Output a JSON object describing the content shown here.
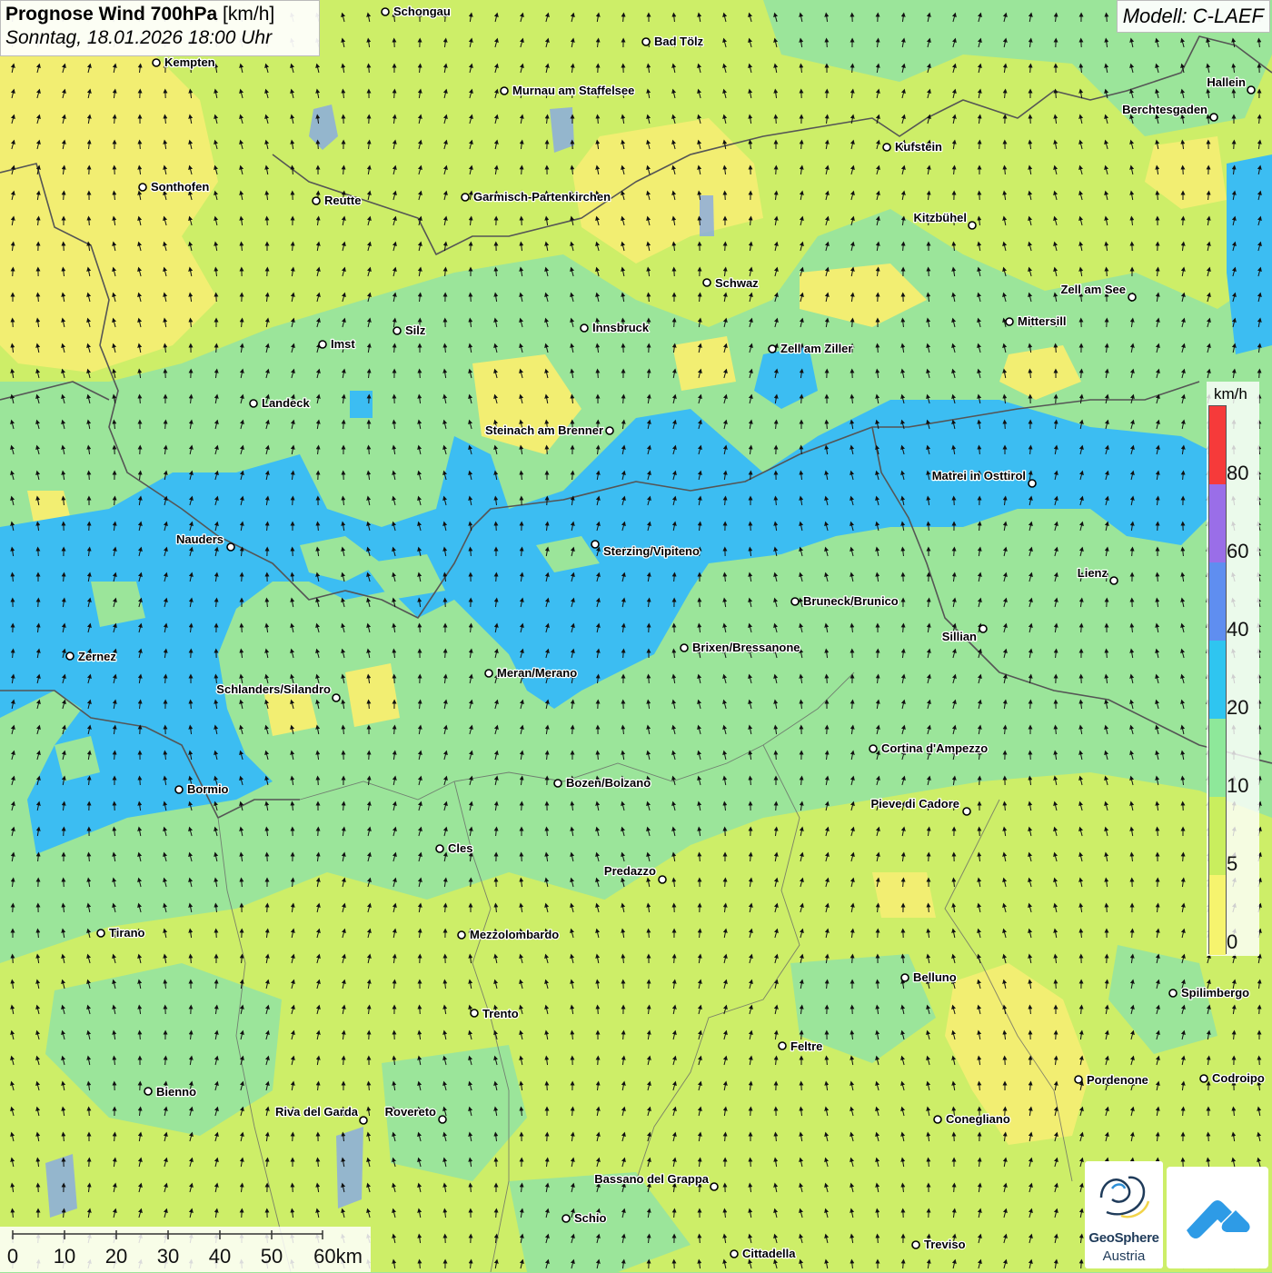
{
  "title": {
    "main": "Prognose Wind 700hPa",
    "unit": "[km/h]",
    "datetime": "Sonntag, 18.01.2026 18:00 Uhr"
  },
  "model": "Modell: C-LAEF",
  "legend": {
    "unit": "km/h",
    "labels": [
      "80",
      "60",
      "40",
      "20",
      "10",
      "5",
      "0"
    ],
    "colors": [
      "#f63a3a",
      "#9a6ee8",
      "#5f8ef0",
      "#2fc5f0",
      "#8ee89a",
      "#c9ee5e",
      "#f6f46e"
    ]
  },
  "scalebar": {
    "labels": [
      "0",
      "10",
      "20",
      "30",
      "40",
      "50",
      "60km"
    ]
  },
  "colors": {
    "yellow": "#f2ee72",
    "lime": "#cdee68",
    "green": "#9be59a",
    "blue": "#3cbdf2",
    "border": "#555555",
    "water": "#86a8e6"
  },
  "cities": [
    {
      "name": "Schongau"
    },
    {
      "name": "Bad Tölz"
    },
    {
      "name": "Kempten"
    },
    {
      "name": "Murnau am Staffelsee"
    },
    {
      "name": "Hallein"
    },
    {
      "name": "Berchtesgaden"
    },
    {
      "name": "Kufstein"
    },
    {
      "name": "Sonthofen"
    },
    {
      "name": "Reutte"
    },
    {
      "name": "Garmisch-Partenkirchen"
    },
    {
      "name": "Kitzbühel"
    },
    {
      "name": "Schwaz"
    },
    {
      "name": "Zell am See"
    },
    {
      "name": "Mittersill"
    },
    {
      "name": "Innsbruck"
    },
    {
      "name": "Imst"
    },
    {
      "name": "Silz"
    },
    {
      "name": "Zell am Ziller"
    },
    {
      "name": "Landeck"
    },
    {
      "name": "Steinach am Brenner"
    },
    {
      "name": "Matrei in Osttirol"
    },
    {
      "name": "Nauders"
    },
    {
      "name": "Sterzing/Vipiteno"
    },
    {
      "name": "Lienz"
    },
    {
      "name": "Bruneck/Brunico"
    },
    {
      "name": "Sillian"
    },
    {
      "name": "Brixen/Bressanone"
    },
    {
      "name": "Zernez"
    },
    {
      "name": "Meran/Merano"
    },
    {
      "name": "Schlanders/Silandro"
    },
    {
      "name": "Cortina d'Ampezzo"
    },
    {
      "name": "Bozen/Bolzano"
    },
    {
      "name": "Bormio"
    },
    {
      "name": "Pieve di Cadore"
    },
    {
      "name": "Cles"
    },
    {
      "name": "Predazzo"
    },
    {
      "name": "Tirano"
    },
    {
      "name": "Mezzolombardo"
    },
    {
      "name": "Belluno"
    },
    {
      "name": "Spilimbergo"
    },
    {
      "name": "Trento"
    },
    {
      "name": "Feltre"
    },
    {
      "name": "Pordenone"
    },
    {
      "name": "Codroipo"
    },
    {
      "name": "Bienno"
    },
    {
      "name": "Riva del Garda"
    },
    {
      "name": "Rovereto"
    },
    {
      "name": "Conegliano"
    },
    {
      "name": "Bassano del Grappa"
    },
    {
      "name": "Schio"
    },
    {
      "name": "Treviso"
    },
    {
      "name": "Cittadella"
    }
  ],
  "logos": {
    "geosphere_line1": "GeoSphere",
    "geosphere_line2": "Austria"
  }
}
